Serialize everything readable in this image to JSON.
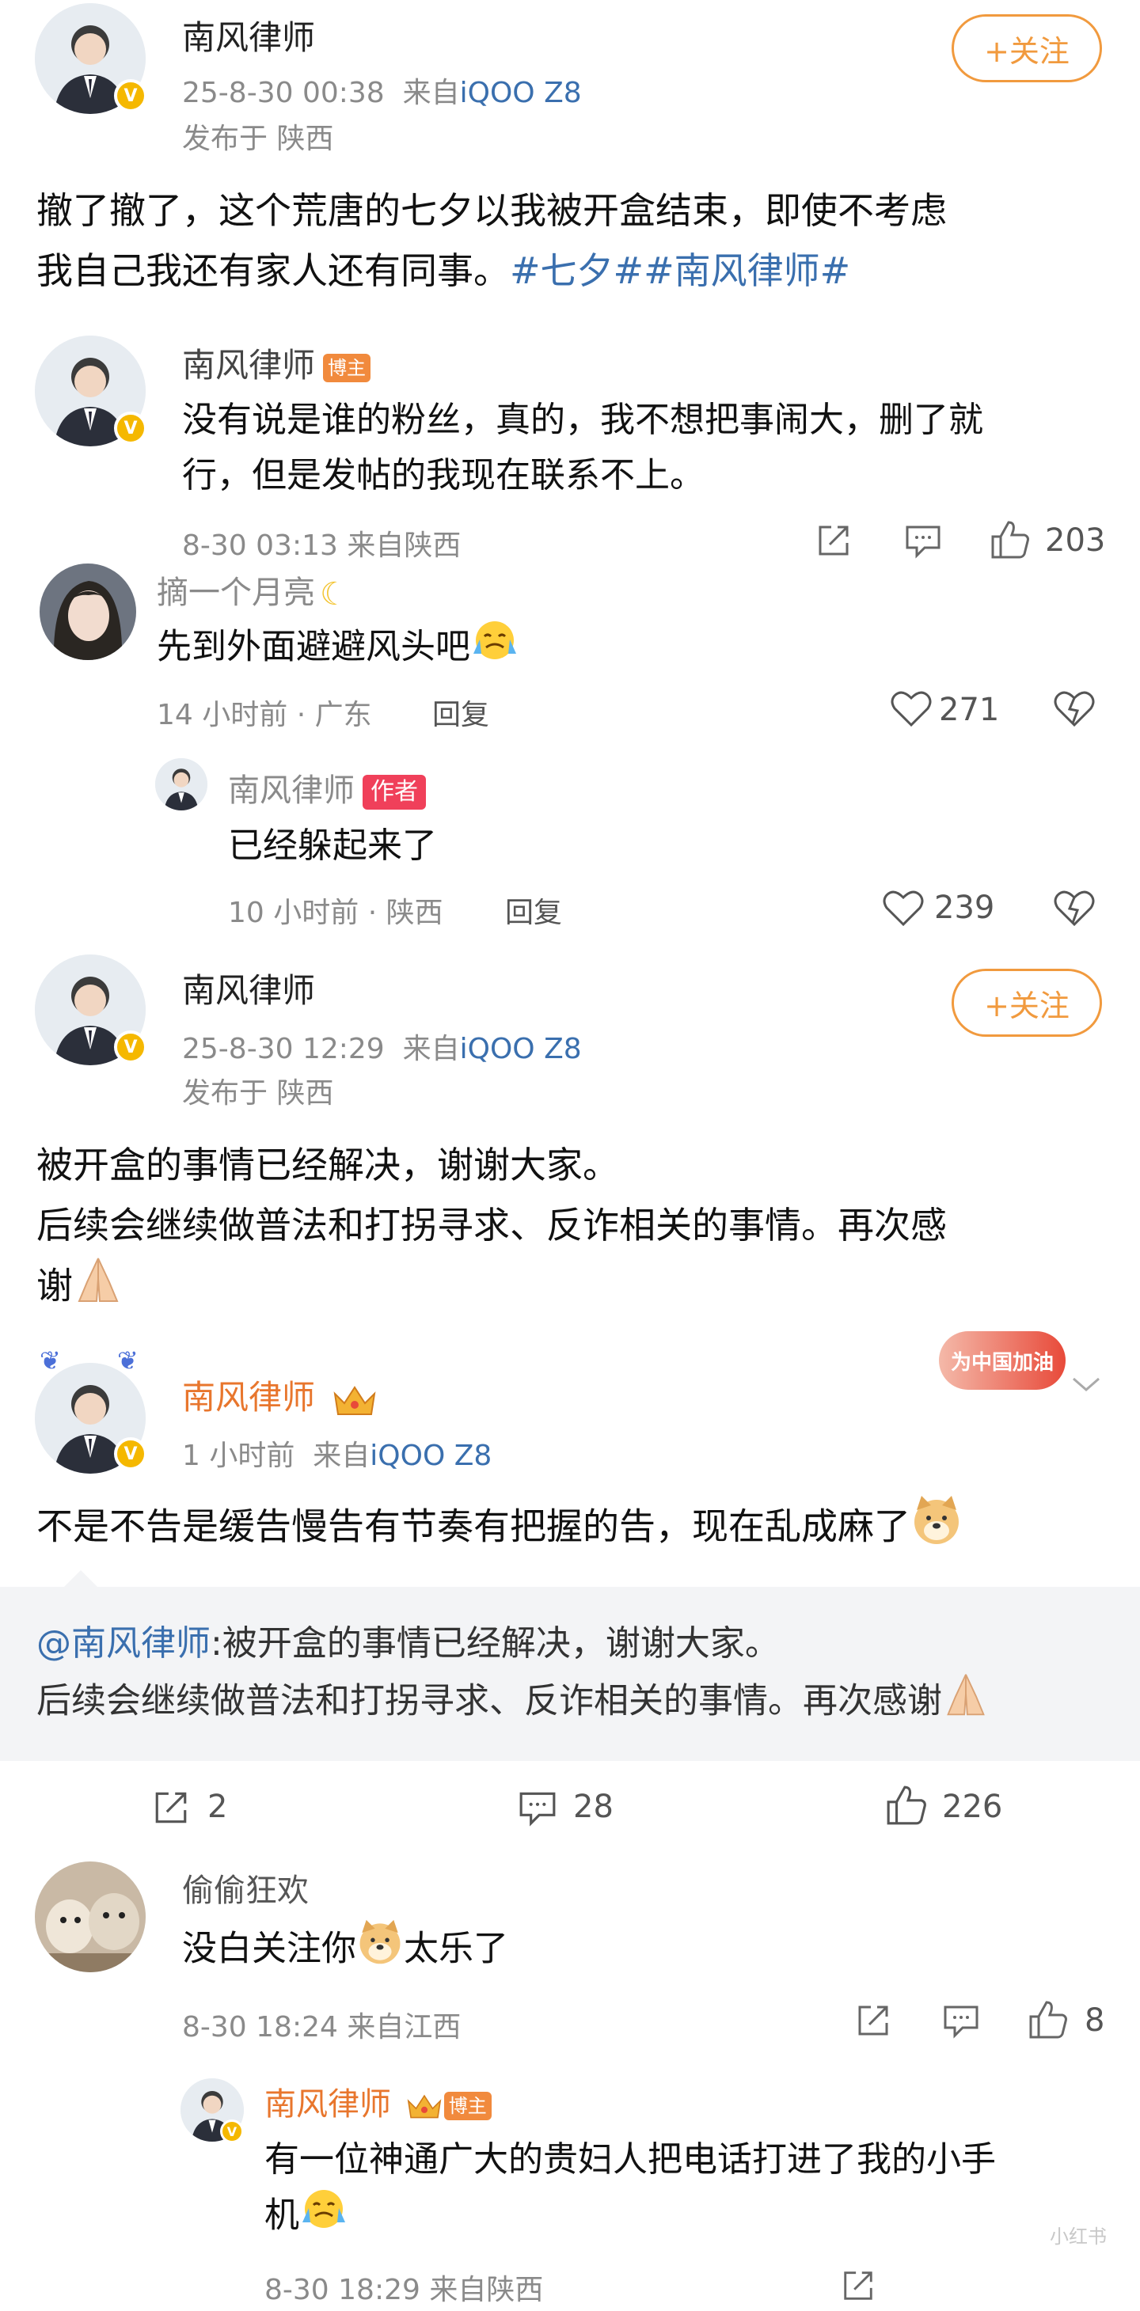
{
  "post1": {
    "author": "南风律师",
    "time": "25-8-30 00:38",
    "source_prefix": "来自",
    "device": "iQOO Z8",
    "location": "发布于 陕西",
    "follow_label": "+关注",
    "text_line1": "撤了撤了，这个荒唐的七夕以我被开盒结束，即使不考虑",
    "text_line2": "我自己我还有家人还有同事。",
    "topic": "#七夕##南风律师#"
  },
  "comment1": {
    "author": "南风律师",
    "badge": "博主",
    "text_line1": "没有说是谁的粉丝，真的，我不想把事闹大，删了就",
    "text_line2": "行，但是发帖的我现在联系不上。",
    "meta": "8-30 03:13  来自陕西",
    "likes": "203"
  },
  "comment2": {
    "author": "摘一个月亮",
    "text": "先到外面避避风头吧",
    "meta": "14 小时前 · 广东",
    "reply_label": "回复",
    "likes": "271"
  },
  "reply1": {
    "author": "南风律师",
    "badge": "作者",
    "text": "已经躲起来了",
    "meta": "10 小时前 · 陕西",
    "reply_label": "回复",
    "likes": "239"
  },
  "post2": {
    "author": "南风律师",
    "time": "25-8-30 12:29",
    "source_prefix": "来自",
    "device": "iQOO Z8",
    "location": "发布于 陕西",
    "follow_label": "+关注",
    "text_line1": "被开盒的事情已经解决，谢谢大家。",
    "text_line2": "后续会继续做普法和打拐寻求、反诈相关的事情。再次感",
    "text_line3": "谢"
  },
  "post3": {
    "author": "南风律师",
    "time": "1 小时前",
    "source_prefix": "来自",
    "device": "iQOO Z8",
    "decoration_text": "为中国加油",
    "text": "不是不告是缓告慢告有节奏有把握的告，现在乱成麻了",
    "quote_mention": "@南风律师",
    "quote_line1": ":被开盒的事情已经解决，谢谢大家。",
    "quote_line2": "后续会继续做普法和打拐寻求、反诈相关的事情。再次感谢",
    "reposts": "2",
    "comments": "28",
    "likes": "226"
  },
  "comment3": {
    "author": "偷偷狂欢",
    "text_before": "没白关注你",
    "text_after": "太乐了",
    "meta": "8-30 18:24  来自江西",
    "likes": "8"
  },
  "reply2": {
    "author": "南风律师",
    "badge": "博主",
    "text_line1": "有一位神通广大的贵妇人把电话打进了我的小手",
    "text_line2": "机",
    "meta": "8-30 18:29  来自陕西"
  },
  "watermark": "小红书",
  "colors": {
    "link_blue": "#3a6fae",
    "follow_orange": "#f19a3e",
    "vip_orange": "#e8762d",
    "verified_gold": "#f5b800",
    "author_red": "#f0405a"
  },
  "icons": [
    "repost-icon",
    "comment-icon",
    "like-icon",
    "heart-icon",
    "dislike-heart-icon",
    "crown-icon",
    "chevron-down-icon",
    "verified-icon"
  ]
}
